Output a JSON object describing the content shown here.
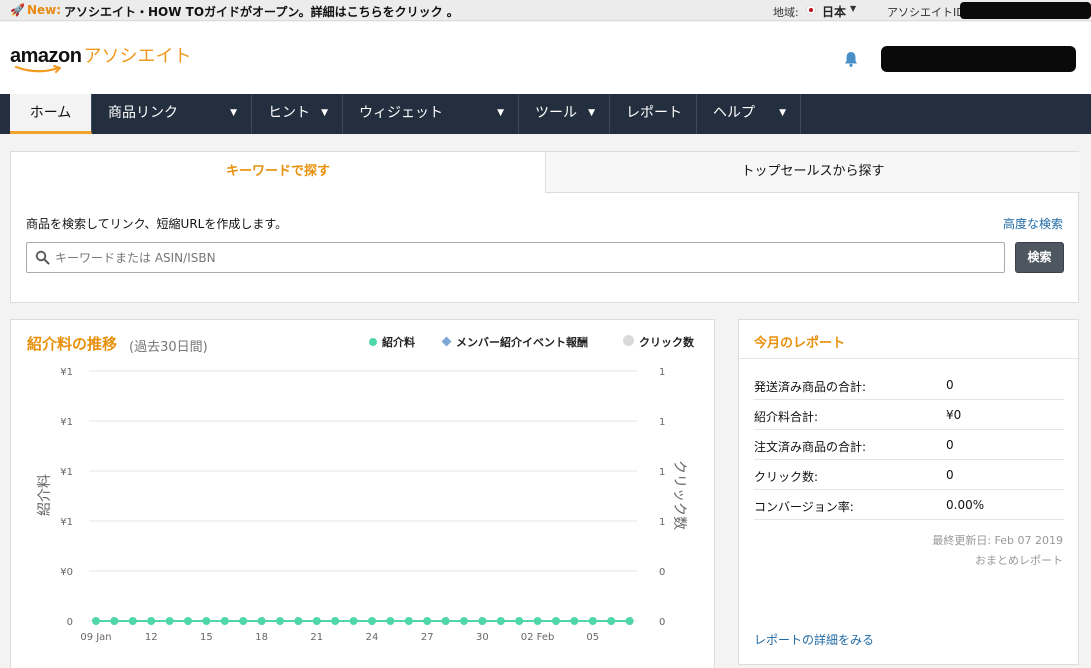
{
  "topbar": {
    "new_label": "New:",
    "message": "アソシエイト・HOW TOガイドがオープン。詳細はこちらをクリック 。",
    "region_label": "地域:",
    "region_value": "日本",
    "associate_id_label": "アソシエイトID:"
  },
  "header": {
    "logo_word": "amazon",
    "logo_suffix": "アソシエイト"
  },
  "nav": {
    "items": [
      {
        "label": "ホーム",
        "dropdown": false
      },
      {
        "label": "商品リンク",
        "dropdown": true
      },
      {
        "label": "ヒント",
        "dropdown": true
      },
      {
        "label": "ウィジェット",
        "dropdown": true
      },
      {
        "label": "ツール",
        "dropdown": true
      },
      {
        "label": "レポート",
        "dropdown": false
      },
      {
        "label": "ヘルプ",
        "dropdown": true
      }
    ]
  },
  "search": {
    "tab_active": "キーワードで探す",
    "tab_inactive": "トップセールスから探す",
    "description": "商品を検索してリンク、短縮URLを作成します。",
    "advanced_link": "高度な検索",
    "placeholder": "キーワードまたは ASIN/ISBN",
    "value": "",
    "button": "検索"
  },
  "chart_panel": {
    "title": "紹介料の推移",
    "subtitle": "(過去30日間)"
  },
  "chart_data": {
    "type": "line",
    "title": "紹介料の推移",
    "ylabel": "紹介料",
    "y2label": "クリック数",
    "series": [
      {
        "name": "紹介料",
        "color": "#4fd6a9",
        "values": [
          0,
          0,
          0,
          0,
          0,
          0,
          0,
          0,
          0,
          0,
          0,
          0,
          0,
          0,
          0,
          0,
          0,
          0,
          0,
          0,
          0,
          0,
          0,
          0,
          0,
          0,
          0,
          0,
          0,
          0
        ]
      },
      {
        "name": "メンバー紹介イベント報酬",
        "color": "#7fa8d8",
        "values": [
          0,
          0,
          0,
          0,
          0,
          0,
          0,
          0,
          0,
          0,
          0,
          0,
          0,
          0,
          0,
          0,
          0,
          0,
          0,
          0,
          0,
          0,
          0,
          0,
          0,
          0,
          0,
          0,
          0,
          0
        ]
      },
      {
        "name": "クリック数",
        "color": "#d9d9d9",
        "values": [
          0,
          0,
          0,
          0,
          0,
          0,
          0,
          0,
          0,
          0,
          0,
          0,
          0,
          0,
          0,
          0,
          0,
          0,
          0,
          0,
          0,
          0,
          0,
          0,
          0,
          0,
          0,
          0,
          0,
          0
        ]
      }
    ],
    "x_tick_labels": [
      "09 Jan",
      "12",
      "15",
      "18",
      "21",
      "24",
      "27",
      "30",
      "02 Feb",
      "05"
    ],
    "y_left_tick_labels": [
      "0",
      "¥0",
      "¥1",
      "¥1",
      "¥1",
      "¥1"
    ],
    "y_right_tick_labels": [
      "0",
      "0",
      "1",
      "1",
      "1",
      "1"
    ],
    "ylim": [
      0,
      1
    ],
    "grid": true,
    "legend": "top-right"
  },
  "report": {
    "title": "今月のレポート",
    "rows": [
      {
        "label": "発送済み商品の合計:",
        "value": "0"
      },
      {
        "label": "紹介料合計:",
        "value": "¥0"
      },
      {
        "label": "注文済み商品の合計:",
        "value": "0"
      },
      {
        "label": "クリック数:",
        "value": "0"
      },
      {
        "label": "コンバージョン率:",
        "value": "0.00%"
      }
    ],
    "last_updated": "最終更新日: Feb 07 2019",
    "summary_link": "おまとめレポート",
    "details_link": "レポートの詳細をみる"
  },
  "colors": {
    "accent": "#e8900b",
    "nav_bg": "#232f3e",
    "link": "#1f6aa5"
  }
}
